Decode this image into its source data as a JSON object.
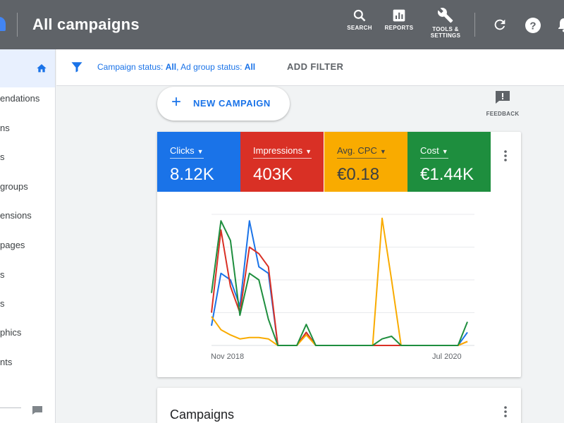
{
  "header": {
    "title": "All campaigns",
    "tools": [
      {
        "icon": "search-icon",
        "label": "SEARCH"
      },
      {
        "icon": "reports-icon",
        "label": "REPORTS"
      },
      {
        "icon": "wrench-icon",
        "label": "TOOLS &\nSETTINGS"
      }
    ],
    "right_icons": [
      "refresh-icon",
      "help-icon",
      "bell-icon"
    ],
    "bg_color": "#5f6368"
  },
  "sidebar": {
    "home_icon": "home-icon",
    "items": [
      "endations",
      "ns",
      "s",
      "groups",
      "ensions",
      "pages",
      "s",
      "s",
      "phics",
      "nts"
    ],
    "footer_icon": "feedback-icon"
  },
  "filter_bar": {
    "icon": "filter-icon",
    "campaign_status_label": "Campaign status: ",
    "campaign_status_value": "All",
    "ad_group_status_label": ", Ad group status: ",
    "ad_group_status_value": "All",
    "add_filter": "ADD FILTER"
  },
  "new_campaign": {
    "icon": "plus-icon",
    "label": "NEW CAMPAIGN"
  },
  "feedback": {
    "icon": "feedback-icon",
    "label": "FEEDBACK"
  },
  "metrics": [
    {
      "label": "Clicks",
      "value": "8.12K",
      "color": "#1a73e8"
    },
    {
      "label": "Impressions",
      "value": "403K",
      "color": "#d93025"
    },
    {
      "label": "Avg. CPC",
      "value": "€0.18",
      "color": "#f9ab00"
    },
    {
      "label": "Cost",
      "value": "€1.44K",
      "color": "#1e8e3e"
    }
  ],
  "chart_data": {
    "type": "line",
    "x_tick_labels": [
      "Nov 2018",
      "Jul 2020"
    ],
    "y_range": [
      0,
      100
    ],
    "grid": true,
    "series": [
      {
        "color": "#1a73e8",
        "values": [
          15,
          55,
          50,
          30,
          95,
          60,
          55,
          0,
          0,
          0,
          10,
          0,
          0,
          0,
          0,
          0,
          0,
          0,
          0,
          0,
          0,
          0,
          0,
          0,
          0,
          0,
          0,
          10
        ]
      },
      {
        "color": "#d93025",
        "values": [
          25,
          88,
          45,
          25,
          75,
          70,
          60,
          0,
          0,
          0,
          10,
          0,
          0,
          0,
          0,
          0,
          0,
          0,
          0,
          0,
          0,
          0,
          0,
          0,
          0,
          0,
          0,
          3
        ]
      },
      {
        "color": "#f9ab00",
        "values": [
          22,
          12,
          8,
          5,
          6,
          6,
          5,
          0,
          0,
          0,
          8,
          0,
          0,
          0,
          0,
          0,
          0,
          0,
          97,
          50,
          0,
          0,
          0,
          0,
          0,
          0,
          0,
          3
        ]
      },
      {
        "color": "#1e8e3e",
        "values": [
          40,
          95,
          80,
          23,
          55,
          50,
          20,
          0,
          0,
          0,
          16,
          0,
          0,
          0,
          0,
          0,
          0,
          0,
          5,
          7,
          0,
          0,
          0,
          0,
          0,
          0,
          0,
          18
        ]
      }
    ]
  },
  "campaigns_card": {
    "title": "Campaigns"
  }
}
